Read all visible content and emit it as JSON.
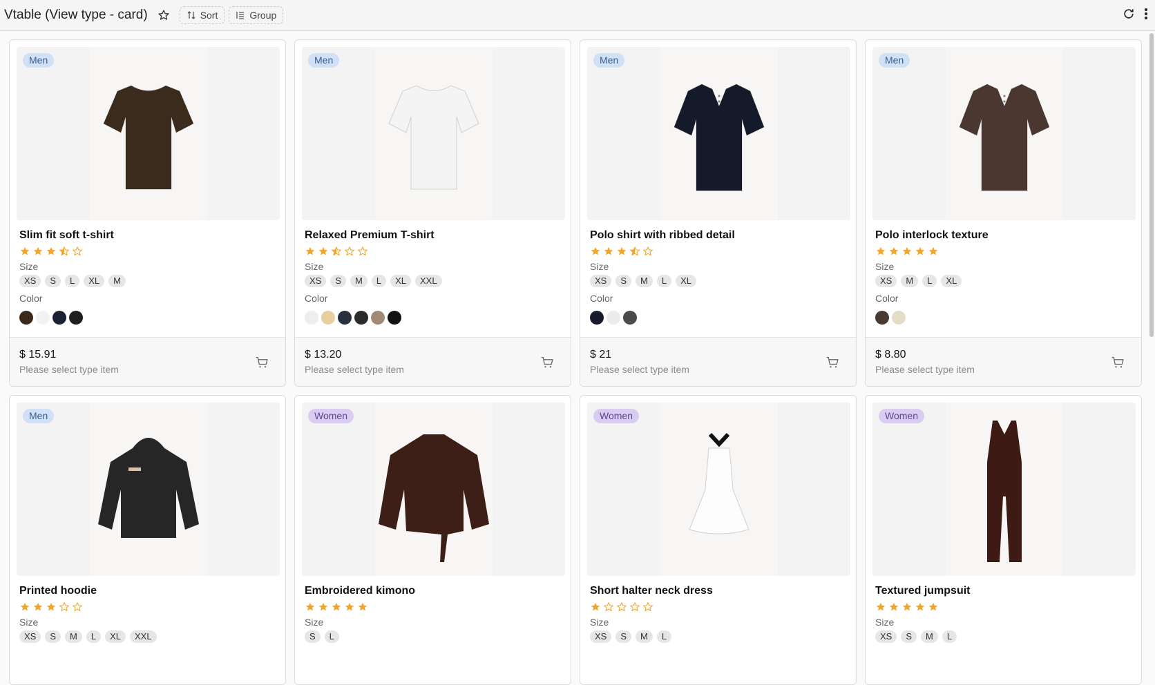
{
  "header": {
    "title": "Vtable (View type - card)",
    "sort_label": "Sort",
    "group_label": "Group"
  },
  "products": [
    {
      "badge": "Men",
      "badge_type": "men",
      "name": "Slim fit soft t-shirt",
      "rating": 3.5,
      "size_label": "Size",
      "sizes": [
        "XS",
        "S",
        "L",
        "XL",
        "M"
      ],
      "color_label": "Color",
      "colors": [
        "#3b2a1c",
        "#f2f2f2",
        "#1c2233",
        "#1f1f1f"
      ],
      "price": "$ 15.91",
      "hint": "Please select type item",
      "garment": "tshirt",
      "garment_color": "#3a2b1d"
    },
    {
      "badge": "Men",
      "badge_type": "men",
      "name": "Relaxed Premium T-shirt",
      "rating": 2.5,
      "size_label": "Size",
      "sizes": [
        "XS",
        "S",
        "M",
        "L",
        "XL",
        "XXL"
      ],
      "color_label": "Color",
      "colors": [
        "#eeeeee",
        "#e8cfa0",
        "#2a2f3e",
        "#2b2b2b",
        "#a08c74",
        "#121212"
      ],
      "price": "$ 13.20",
      "hint": "Please select type item",
      "garment": "tshirt",
      "garment_color": "#f4f4f4"
    },
    {
      "badge": "Men",
      "badge_type": "men",
      "name": "Polo shirt with ribbed detail",
      "rating": 3.5,
      "size_label": "Size",
      "sizes": [
        "XS",
        "S",
        "M",
        "L",
        "XL"
      ],
      "color_label": "Color",
      "colors": [
        "#161c2c",
        "#ececec",
        "#4b4b4b"
      ],
      "price": "$ 21",
      "hint": "Please select type item",
      "garment": "polo",
      "garment_color": "#141a2a"
    },
    {
      "badge": "Men",
      "badge_type": "men",
      "name": "Polo interlock texture",
      "rating": 5,
      "size_label": "Size",
      "sizes": [
        "XS",
        "M",
        "L",
        "XL"
      ],
      "color_label": "Color",
      "colors": [
        "#4a3a32",
        "#e4ddc8"
      ],
      "price": "$ 8.80",
      "hint": "Please select type item",
      "garment": "polo",
      "garment_color": "#4a3830"
    },
    {
      "badge": "Men",
      "badge_type": "men",
      "name": "Printed hoodie",
      "rating": 3,
      "size_label": "Size",
      "sizes": [
        "XS",
        "S",
        "M",
        "L",
        "XL",
        "XXL"
      ],
      "garment": "hoodie",
      "garment_color": "#262626"
    },
    {
      "badge": "Women",
      "badge_type": "women",
      "name": "Embroidered kimono",
      "rating": 5,
      "size_label": "Size",
      "sizes": [
        "S",
        "L"
      ],
      "garment": "kimono",
      "garment_color": "#3e1f17"
    },
    {
      "badge": "Women",
      "badge_type": "women",
      "name": "Short halter neck dress",
      "rating": 1,
      "size_label": "Size",
      "sizes": [
        "XS",
        "S",
        "M",
        "L"
      ],
      "garment": "dress",
      "garment_color": "#ffffff"
    },
    {
      "badge": "Women",
      "badge_type": "women",
      "name": "Textured jumpsuit",
      "rating": 5,
      "size_label": "Size",
      "sizes": [
        "XS",
        "S",
        "M",
        "L"
      ],
      "garment": "jumpsuit",
      "garment_color": "#3d1a14"
    }
  ],
  "colors": {
    "star": "#f0a52b",
    "star_empty": "#f0a52b"
  }
}
